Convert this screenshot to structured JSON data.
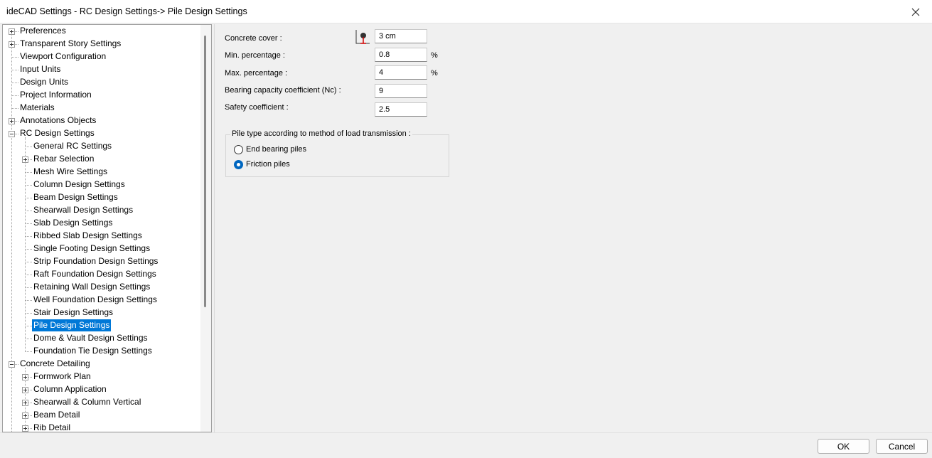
{
  "window": {
    "title": "ideCAD Settings - RC Design Settings-> Pile Design Settings"
  },
  "tree": {
    "items": [
      {
        "label": "Preferences",
        "level": 0,
        "expander": "plus"
      },
      {
        "label": "Transparent Story Settings",
        "level": 0,
        "expander": "plus"
      },
      {
        "label": "Viewport Configuration",
        "level": 0,
        "expander": "none"
      },
      {
        "label": "Input Units",
        "level": 0,
        "expander": "none"
      },
      {
        "label": "Design Units",
        "level": 0,
        "expander": "none"
      },
      {
        "label": "Project Information",
        "level": 0,
        "expander": "none"
      },
      {
        "label": "Materials",
        "level": 0,
        "expander": "none"
      },
      {
        "label": "Annotations Objects",
        "level": 0,
        "expander": "plus"
      },
      {
        "label": "RC Design Settings",
        "level": 0,
        "expander": "minus"
      },
      {
        "label": "General RC Settings",
        "level": 1,
        "expander": "none"
      },
      {
        "label": "Rebar Selection",
        "level": 1,
        "expander": "plus"
      },
      {
        "label": "Mesh Wire Settings",
        "level": 1,
        "expander": "none"
      },
      {
        "label": "Column Design Settings",
        "level": 1,
        "expander": "none"
      },
      {
        "label": "Beam Design Settings",
        "level": 1,
        "expander": "none"
      },
      {
        "label": "Shearwall Design Settings",
        "level": 1,
        "expander": "none"
      },
      {
        "label": "Slab Design Settings",
        "level": 1,
        "expander": "none"
      },
      {
        "label": "Ribbed Slab Design Settings",
        "level": 1,
        "expander": "none"
      },
      {
        "label": "Single Footing Design Settings",
        "level": 1,
        "expander": "none"
      },
      {
        "label": "Strip Foundation Design Settings",
        "level": 1,
        "expander": "none"
      },
      {
        "label": "Raft Foundation Design Settings",
        "level": 1,
        "expander": "none"
      },
      {
        "label": "Retaining Wall Design Settings",
        "level": 1,
        "expander": "none"
      },
      {
        "label": "Well Foundation Design Settings",
        "level": 1,
        "expander": "none"
      },
      {
        "label": "Stair Design Settings",
        "level": 1,
        "expander": "none"
      },
      {
        "label": "Pile Design Settings",
        "level": 1,
        "expander": "none",
        "selected": true
      },
      {
        "label": "Dome & Vault Design Settings",
        "level": 1,
        "expander": "none"
      },
      {
        "label": "Foundation Tie Design Settings",
        "level": 1,
        "expander": "none"
      },
      {
        "label": "Concrete Detailing",
        "level": 0,
        "expander": "minus"
      },
      {
        "label": "Formwork Plan",
        "level": 1,
        "expander": "plus"
      },
      {
        "label": "Column Application",
        "level": 1,
        "expander": "plus"
      },
      {
        "label": "Shearwall & Column Vertical",
        "level": 1,
        "expander": "plus"
      },
      {
        "label": "Beam Detail",
        "level": 1,
        "expander": "plus"
      },
      {
        "label": "Rib Detail",
        "level": 1,
        "expander": "plus"
      }
    ]
  },
  "form": {
    "concrete_cover": {
      "label": "Concrete cover :",
      "value": "3 cm"
    },
    "min_percentage": {
      "label": "Min. percentage :",
      "value": "0.8",
      "unit": "%"
    },
    "max_percentage": {
      "label": "Max. percentage :",
      "value": "4",
      "unit": "%"
    },
    "bearing_coefficient": {
      "label": "Bearing capacity coefficient (Nc) :",
      "value": "9"
    },
    "safety_coefficient": {
      "label": "Safety coefficient :",
      "value": "2.5"
    }
  },
  "pile_type": {
    "title": "Pile type according to method of load transmission :",
    "options": [
      {
        "label": "End bearing piles",
        "checked": false
      },
      {
        "label": "Friction piles",
        "checked": true
      }
    ]
  },
  "buttons": {
    "ok": "OK",
    "cancel": "Cancel"
  }
}
